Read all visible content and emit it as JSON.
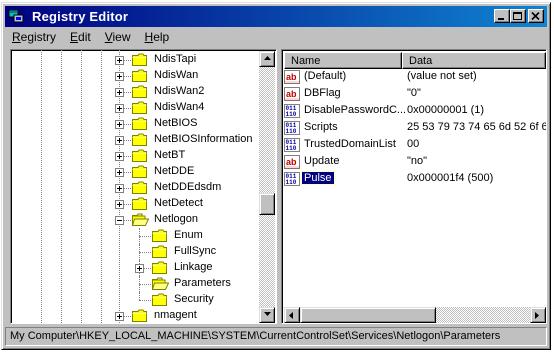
{
  "window": {
    "title": "Registry Editor"
  },
  "menubar": [
    {
      "label": "Registry",
      "ul": "R",
      "rest": "egistry"
    },
    {
      "label": "Edit",
      "ul": "E",
      "rest": "dit"
    },
    {
      "label": "View",
      "ul": "V",
      "rest": "iew"
    },
    {
      "label": "Help",
      "ul": "H",
      "rest": "elp"
    }
  ],
  "tree": {
    "nodes": [
      {
        "label": "NdisTapi",
        "expander": "plus"
      },
      {
        "label": "NdisWan",
        "expander": "plus"
      },
      {
        "label": "NdisWan2",
        "expander": "plus"
      },
      {
        "label": "NdisWan4",
        "expander": "plus"
      },
      {
        "label": "NetBIOS",
        "expander": "plus"
      },
      {
        "label": "NetBIOSInformation",
        "expander": "plus"
      },
      {
        "label": "NetBT",
        "expander": "plus"
      },
      {
        "label": "NetDDE",
        "expander": "plus"
      },
      {
        "label": "NetDDEdsdm",
        "expander": "plus"
      },
      {
        "label": "NetDetect",
        "expander": "plus"
      },
      {
        "label": "Netlogon",
        "expander": "minus",
        "open": true
      },
      {
        "label": "Enum",
        "child": true
      },
      {
        "label": "FullSync",
        "child": true
      },
      {
        "label": "Linkage",
        "child": true,
        "expander": "plus"
      },
      {
        "label": "Parameters",
        "child": true,
        "open": true
      },
      {
        "label": "Security",
        "child": true
      },
      {
        "label": "nmagent",
        "expander": "plus"
      }
    ]
  },
  "list": {
    "columns": {
      "name": "Name",
      "data": "Data"
    },
    "rows": [
      {
        "type": "string",
        "name": "(Default)",
        "data": "(value not set)"
      },
      {
        "type": "string",
        "name": "DBFlag",
        "data": "\"0\""
      },
      {
        "type": "binary",
        "name": "DisablePasswordC...",
        "data": "0x00000001 (1)"
      },
      {
        "type": "binary",
        "name": "Scripts",
        "data": "25 53 79 73 74 65 6d 52 6f 6"
      },
      {
        "type": "binary",
        "name": "TrustedDomainList",
        "data": "00"
      },
      {
        "type": "string",
        "name": "Update",
        "data": "\"no\""
      },
      {
        "type": "binary",
        "name": "Pulse",
        "data": "0x000001f4 (500)",
        "selected": true
      }
    ]
  },
  "status": {
    "path": "My Computer\\HKEY_LOCAL_MACHINE\\SYSTEM\\CurrentControlSet\\Services\\Netlogon\\Parameters"
  },
  "colors": {
    "title_start": "#000080",
    "title_end": "#1084d0",
    "face": "#c0c0c0",
    "selection": "#000080",
    "folder": "#ffff00"
  },
  "icons": {
    "app": "registry-editor-icon",
    "folder": "folder-icon",
    "open_folder": "open-folder-icon",
    "string_value": "string-value-icon",
    "binary_value": "binary-value-icon",
    "minimize": "minimize-icon",
    "maximize": "maximize-icon",
    "close": "close-icon"
  }
}
